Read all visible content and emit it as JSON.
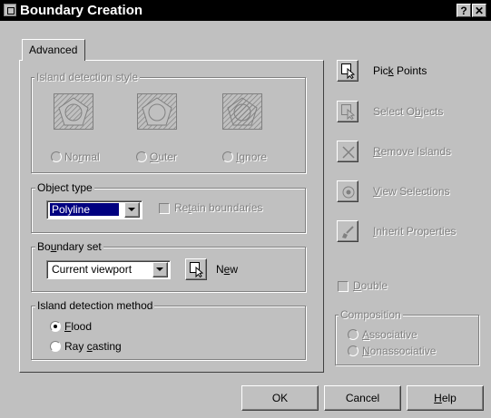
{
  "dialog": {
    "title": "Boundary Creation",
    "help_glyph": "?",
    "close_glyph": "✕"
  },
  "tab": {
    "label": "Advanced"
  },
  "island_style": {
    "label": "Island detection style",
    "options": [
      {
        "pre": "No",
        "ul": "r",
        "post": "mal"
      },
      {
        "pre": "",
        "ul": "O",
        "post": "uter"
      },
      {
        "pre": "",
        "ul": "I",
        "post": "gnore"
      }
    ]
  },
  "object_type": {
    "label": "Object type",
    "value": "Polyline",
    "retain_pre": "Re",
    "retain_ul": "t",
    "retain_post": "ain boundaries"
  },
  "boundary_set": {
    "label_pre": "Bo",
    "label_ul": "u",
    "label_post": "ndary set",
    "value": "Current viewport",
    "new_pre": "N",
    "new_ul": "e",
    "new_post": "w"
  },
  "detection_method": {
    "label": "Island detection method",
    "flood_pre": "",
    "flood_ul": "F",
    "flood_post": "lood",
    "ray_pre": "Ray ",
    "ray_ul": "c",
    "ray_post": "asting"
  },
  "actions": {
    "pick_pre": "Pic",
    "pick_ul": "k",
    "pick_post": " Points",
    "select_pre": "Select O",
    "select_ul": "b",
    "select_post": "jects",
    "remove_pre": "",
    "remove_ul": "R",
    "remove_post": "emove Islands",
    "view_pre": "",
    "view_ul": "V",
    "view_post": "iew Selections",
    "inherit_pre": "",
    "inherit_ul": "I",
    "inherit_post": "nherit Properties"
  },
  "double": {
    "pre": "",
    "ul": "D",
    "post": "ouble"
  },
  "composition": {
    "label": "Composition",
    "assoc_pre": "",
    "assoc_ul": "A",
    "assoc_post": "ssociative",
    "nonassoc_pre": "",
    "nonassoc_ul": "N",
    "nonassoc_post": "onassociative"
  },
  "footer": {
    "ok": "OK",
    "cancel": "Cancel",
    "help_pre": "",
    "help_ul": "H",
    "help_post": "elp"
  }
}
